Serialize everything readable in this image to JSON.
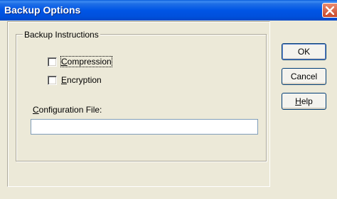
{
  "window": {
    "title": "Backup Options"
  },
  "group": {
    "legend": "Backup Instructions",
    "options": [
      {
        "label_first": "C",
        "label_rest": "ompression",
        "checked": false
      },
      {
        "label_first": "E",
        "label_rest": "ncryption",
        "checked": false
      }
    ]
  },
  "config": {
    "label_first": "C",
    "label_rest": "onfiguration File:",
    "value": ""
  },
  "buttons": {
    "ok": "OK",
    "cancel": "Cancel",
    "help_first": "H",
    "help_rest": "elp"
  },
  "icons": {
    "close": "close-icon"
  },
  "colors": {
    "titlebar": "#0055e5",
    "dialog_bg": "#ece9d8",
    "close": "#c8482b"
  }
}
